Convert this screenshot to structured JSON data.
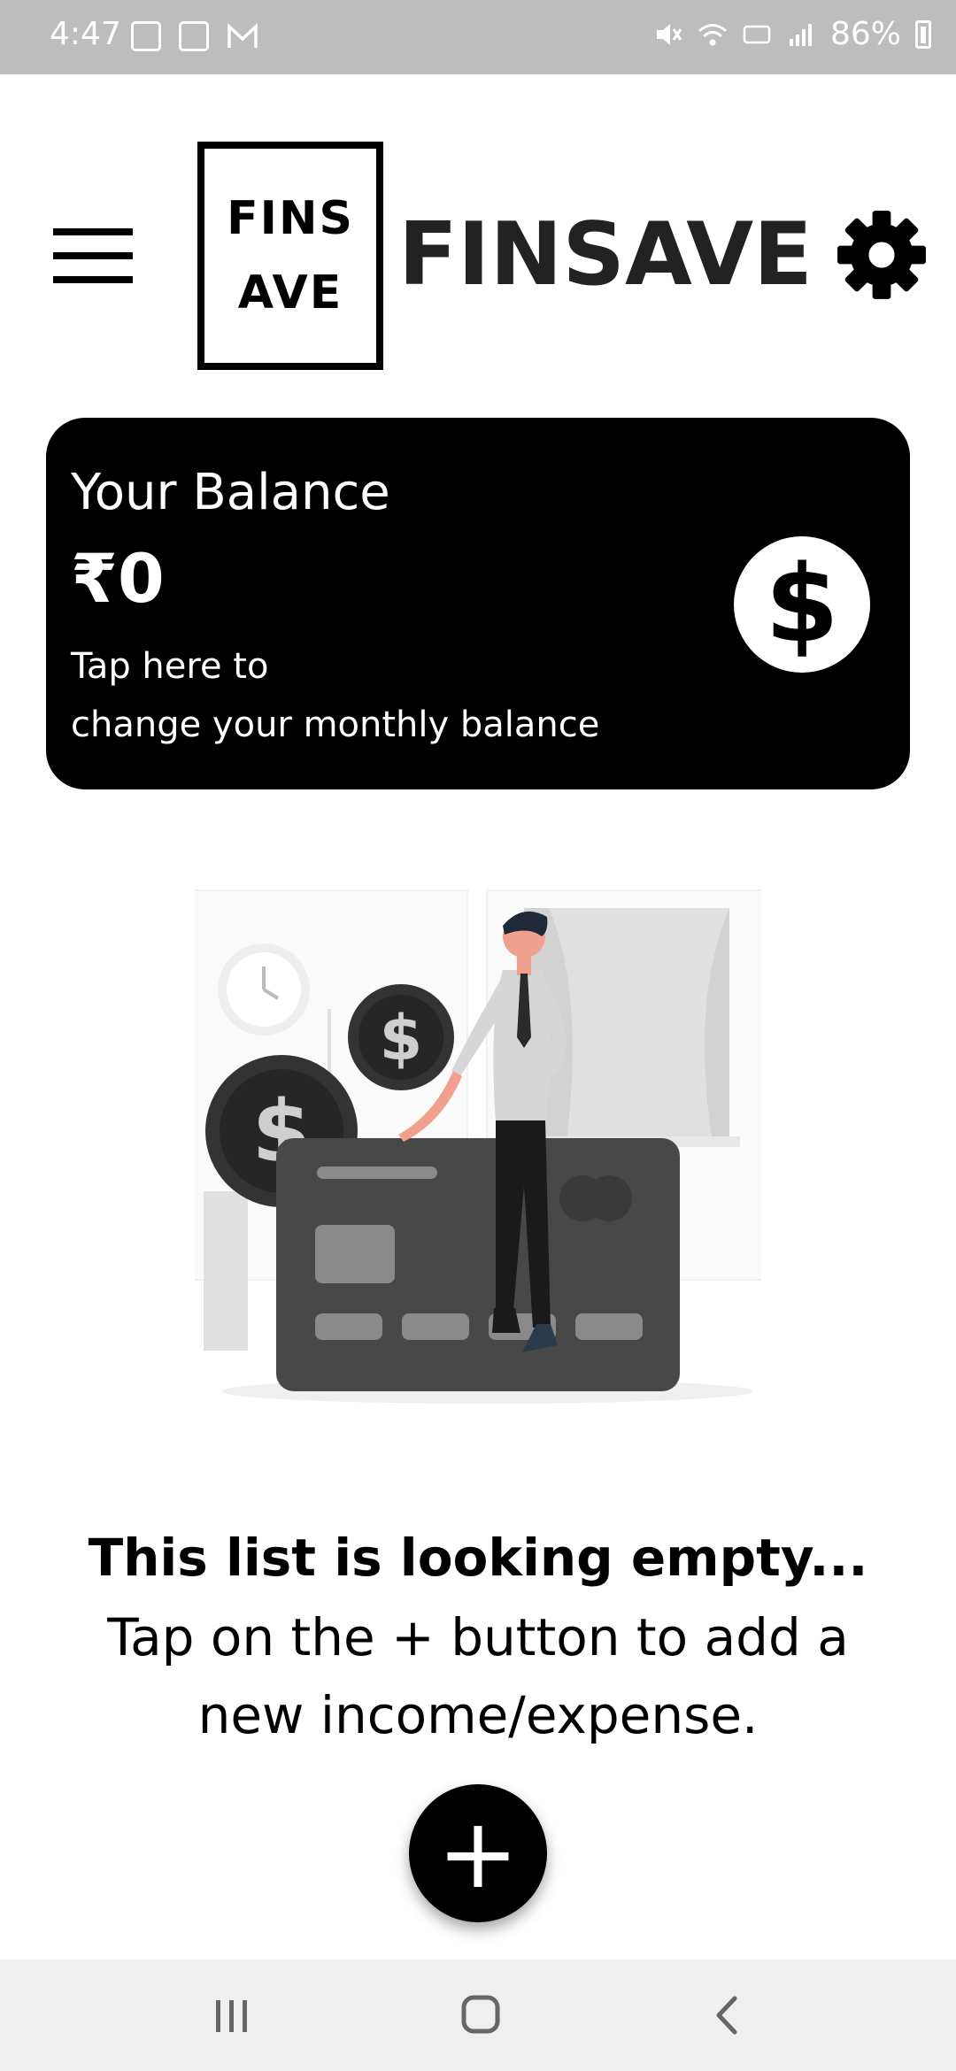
{
  "status_bar": {
    "time": "4:47",
    "battery": "86%"
  },
  "header": {
    "logo_line1": "FINS",
    "logo_line2": "AVE",
    "title": "FINSAVE"
  },
  "balance_card": {
    "label": "Your Balance",
    "amount": "₹0",
    "hint_line1": "Tap here to",
    "hint_line2": "change your monthly balance",
    "icon": "dollar-icon"
  },
  "empty_state": {
    "title": "This list is looking empty...",
    "body_line1": "Tap on the + button to add a",
    "body_line2": "new income/expense."
  },
  "fab": {
    "label": "+"
  },
  "colors": {
    "primary": "#000000",
    "background": "#ffffff",
    "status_bar": "#bdbdbd",
    "nav_bar": "#efefef"
  }
}
